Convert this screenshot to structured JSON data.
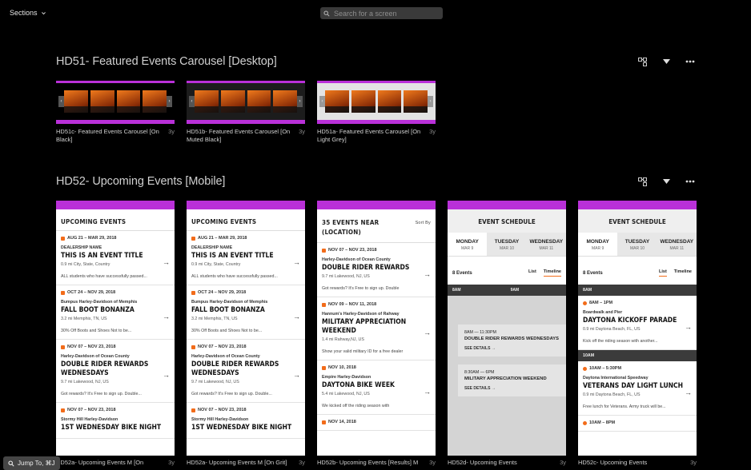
{
  "topbar": {
    "sections_label": "Sections",
    "search_placeholder": "Search for a screen"
  },
  "sections": [
    {
      "title": "HD51- Featured Events Carousel [Desktop]",
      "screens": [
        {
          "name": "HD51c- Featured Events Carousel [On Black]",
          "age": "3y",
          "bg": "#000000"
        },
        {
          "name": "HD51b- Featured Events Carousel [On Muted Black]",
          "age": "3y",
          "bg": "#1c1c1c"
        },
        {
          "name": "HD51a- Featured Events Carousel [On Light Grey]",
          "age": "3y",
          "bg": "#e3e3e3"
        }
      ]
    },
    {
      "title": "HD52- Upcoming Events [Mobile]",
      "screens": [
        {
          "name": "HD52a- Upcoming Events M [On",
          "age": "3y"
        },
        {
          "name": "HD52a- Upcoming Events M [On Grit]",
          "age": "3y"
        },
        {
          "name": "HD52b- Upcoming Events [Results] M",
          "age": "3y"
        },
        {
          "name": "HD52d- Upcoming Events",
          "age": "3y"
        },
        {
          "name": "HD52c- Upcoming Events",
          "age": "3y"
        }
      ]
    }
  ],
  "mock": {
    "upcoming": {
      "title": "UPCOMING EVENTS",
      "events": [
        {
          "date": "AUG 21 – MAR 29, 2018",
          "org": "DEALERSHIP NAME",
          "name": "THIS IS AN EVENT TITLE",
          "meta": "0.9 mi      City, State, Country",
          "desc": "ALL students who have successfully passed..."
        },
        {
          "date": "OCT 24 – NOV 29, 2018",
          "org": "Bumpus Harley-Davidson of Memphis",
          "name": "FALL BOOT BONANZA",
          "meta": "3.2 mi      Memphis, TN, US",
          "desc": "30% Off Boots and Shoes Not to be..."
        },
        {
          "date": "NOV 07 – NOV 23, 2018",
          "org": "Harley-Davidson of Ocean County",
          "name": "DOUBLE RIDER REWARDS WEDNESDAYS",
          "meta": "9.7 mi      Lakewood, NJ, US",
          "desc": "Got rewards? It's Free to sign up. Double..."
        },
        {
          "date": "NOV 07 – NOV 23, 2018",
          "org": "Stormy Hill Harley-Davidson",
          "name": "1ST WEDNESDAY BIKE NIGHT",
          "meta": "",
          "desc": ""
        }
      ]
    },
    "results": {
      "title": "35 EVENTS NEAR (LOCATION)",
      "sort": "Sort By",
      "events": [
        {
          "date": "NOV 07 – NOV 23, 2018",
          "org": "Harley-Davidson of Ocean County",
          "name": "DOUBLE RIDER REWARDS",
          "meta": "9.7 mi      Lakewood, NJ, US",
          "desc": "Got rewards? It's Free to sign up. Double"
        },
        {
          "date": "NOV 09 – NOV 11, 2018",
          "org": "Hannum's Harley-Davidson of Rahway",
          "name": "MILITARY APPRECIATION WEEKEND",
          "meta": "1.4 mi      Rahway,NJ, US",
          "desc": "Show your valid military ID for a free dealer"
        },
        {
          "date": "NOV 10, 2018",
          "org": "Empire Harley-Davidson",
          "name": "DAYTONA BIKE WEEK",
          "meta": "5.4 mi      Lakewood, NJ, US",
          "desc": "We kicked off the riding season with"
        },
        {
          "date": "NOV 14, 2018",
          "org": "",
          "name": "",
          "meta": "",
          "desc": ""
        }
      ]
    },
    "schedule": {
      "title": "EVENT SCHEDULE",
      "days": [
        {
          "d": "MONDAY",
          "m": "MAR 9"
        },
        {
          "d": "TUESDAY",
          "m": "MAR 10"
        },
        {
          "d": "WEDNESDAY",
          "m": "MAR 11"
        }
      ],
      "count": "8 Events",
      "tab_list": "List",
      "tab_timeline": "Timeline",
      "t8": "8AM",
      "t9": "9AM",
      "t10": "10AM",
      "box1_time": "8AM — 11:30PM",
      "box1_name": "DOUBLE RIDER REWARDS WEDNESDAYS",
      "see": "SEE DETAILS",
      "box2_time": "8:30AM — 6PM",
      "box2_name": "MILITARY APPRECIATION WEEKEND",
      "list_events": [
        {
          "time": "8AM – 1PM",
          "org": "Boardwalk and Pier",
          "name": "DAYTONA KICKOFF PARADE",
          "meta": "0.9 mi      Daytona Beach, FL, US",
          "desc": "Kick off the riding season with another..."
        },
        {
          "time": "10AM – 5:30PM",
          "org": "Daytona International Speedway",
          "name": "VETERANS DAY LIGHT LUNCH",
          "meta": "0.9 mi      Daytona Beach, FL, US",
          "desc": "Free lunch for Veterans. Army truck will be..."
        },
        {
          "time": "10AM – 8PM",
          "org": "",
          "name": "",
          "meta": "",
          "desc": ""
        }
      ]
    }
  },
  "jump": {
    "label": "Jump To, ⌘J"
  }
}
